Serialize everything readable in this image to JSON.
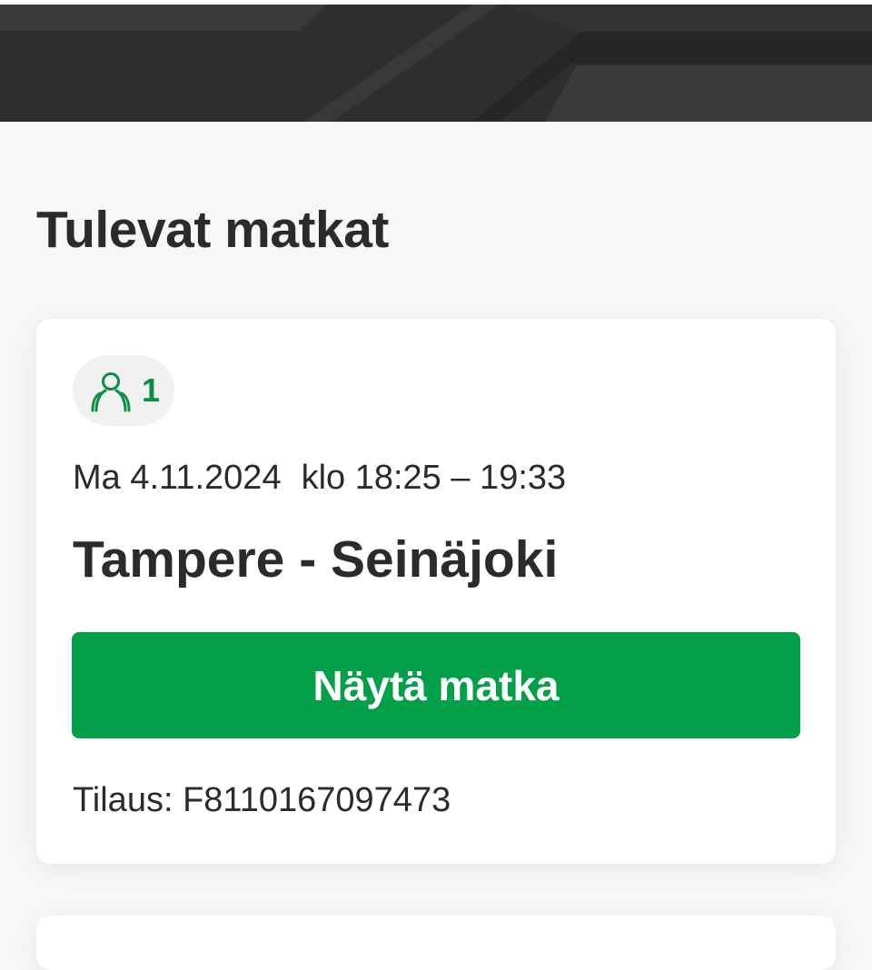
{
  "header": {
    "background_color": "#2e2e2e"
  },
  "page": {
    "title": "Tulevat matkat"
  },
  "trip_card": {
    "passenger_icon": "person-icon",
    "passenger_count": "1",
    "date": "Ma 4.11.2024",
    "time": "klo 18:25 – 19:33",
    "route": "Tampere - Seinäjoki",
    "show_button_label": "Näytä matka",
    "order_label": "Tilaus:",
    "order_number": "F8110167097473",
    "accent_color": "#02a049",
    "icon_color": "#0b8f46"
  }
}
